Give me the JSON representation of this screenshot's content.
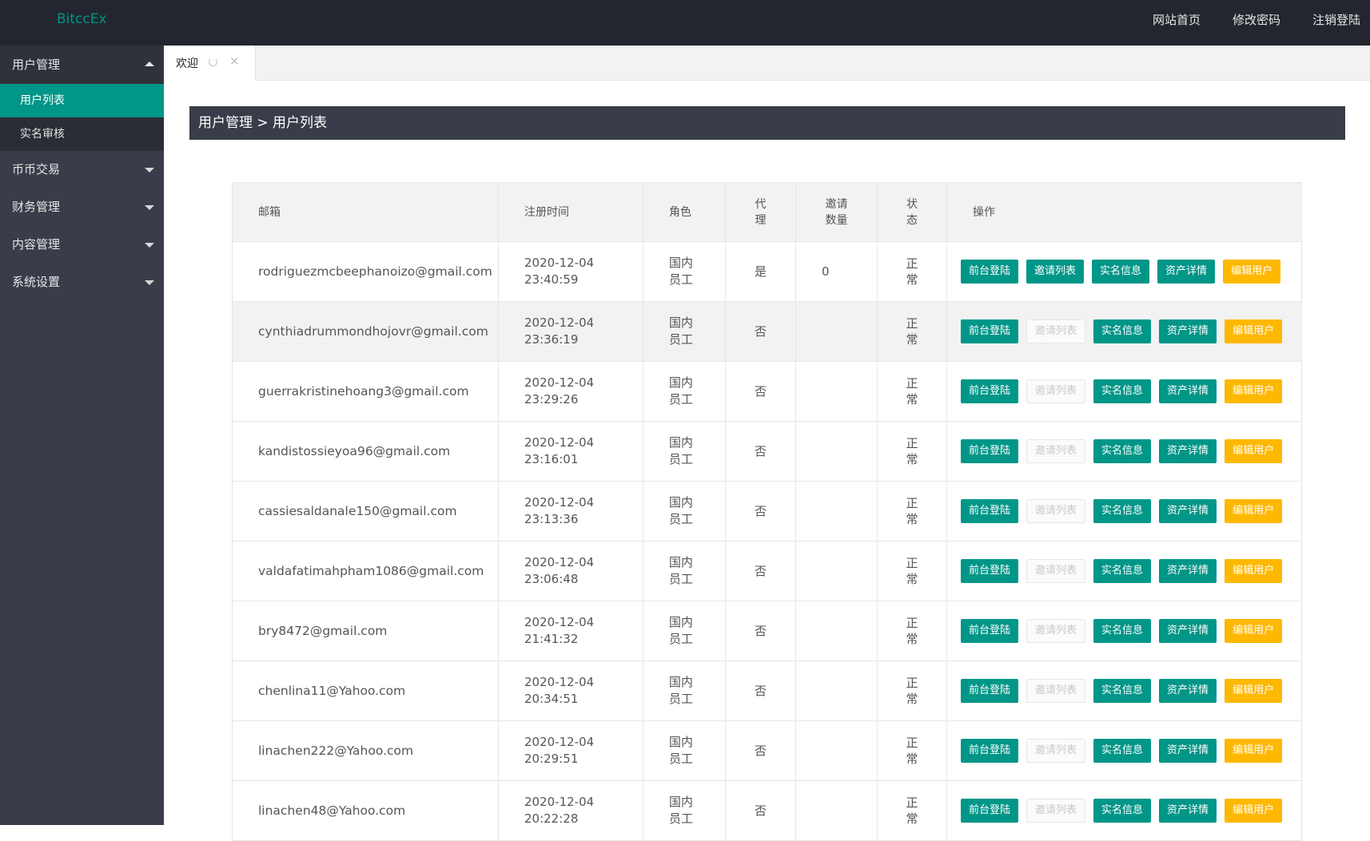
{
  "header": {
    "logo": "BitccEx",
    "nav": [
      "网站首页",
      "修改密码",
      "注销登陆"
    ]
  },
  "sidebar": {
    "menus": [
      {
        "label": "用户管理",
        "open": true,
        "children": [
          {
            "label": "用户列表",
            "active": true
          },
          {
            "label": "实名审核",
            "active": false
          }
        ]
      },
      {
        "label": "币币交易",
        "open": false
      },
      {
        "label": "财务管理",
        "open": false
      },
      {
        "label": "内容管理",
        "open": false
      },
      {
        "label": "系统设置",
        "open": false
      }
    ]
  },
  "tab": {
    "label": "欢迎",
    "close_glyph": "×"
  },
  "breadcrumb": "用户管理 > 用户列表",
  "table": {
    "headers": {
      "email": "邮箱",
      "reg_time": "注册时间",
      "role": "角色",
      "agent": "代理",
      "invite_count": "邀请数量",
      "status": "状态",
      "ops": "操作"
    },
    "buttons": {
      "login": "前台登陆",
      "invites": "邀请列表",
      "realname": "实名信息",
      "assets": "资产详情",
      "edit": "编辑用户"
    },
    "rows": [
      {
        "email": "rodriguezmcbeephanoizo@gmail.com",
        "date": "2020-12-04",
        "time": "23:40:59",
        "role": "国内员工",
        "agent": "是",
        "invites": "0",
        "status": "正常",
        "invite_enabled": true,
        "highlight": false
      },
      {
        "email": "cynthiadrummondhojovr@gmail.com",
        "date": "2020-12-04",
        "time": "23:36:19",
        "role": "国内员工",
        "agent": "否",
        "invites": "",
        "status": "正常",
        "invite_enabled": false,
        "highlight": true
      },
      {
        "email": "guerrakristinehoang3@gmail.com",
        "date": "2020-12-04",
        "time": "23:29:26",
        "role": "国内员工",
        "agent": "否",
        "invites": "",
        "status": "正常",
        "invite_enabled": false,
        "highlight": false
      },
      {
        "email": "kandistossieyoa96@gmail.com",
        "date": "2020-12-04",
        "time": "23:16:01",
        "role": "国内员工",
        "agent": "否",
        "invites": "",
        "status": "正常",
        "invite_enabled": false,
        "highlight": false
      },
      {
        "email": "cassiesaldanale150@gmail.com",
        "date": "2020-12-04",
        "time": "23:13:36",
        "role": "国内员工",
        "agent": "否",
        "invites": "",
        "status": "正常",
        "invite_enabled": false,
        "highlight": false
      },
      {
        "email": "valdafatimahpham1086@gmail.com",
        "date": "2020-12-04",
        "time": "23:06:48",
        "role": "国内员工",
        "agent": "否",
        "invites": "",
        "status": "正常",
        "invite_enabled": false,
        "highlight": false
      },
      {
        "email": "bry8472@gmail.com",
        "date": "2020-12-04",
        "time": "21:41:32",
        "role": "国内员工",
        "agent": "否",
        "invites": "",
        "status": "正常",
        "invite_enabled": false,
        "highlight": false
      },
      {
        "email": "chenlina11@Yahoo.com",
        "date": "2020-12-04",
        "time": "20:34:51",
        "role": "国内员工",
        "agent": "否",
        "invites": "",
        "status": "正常",
        "invite_enabled": false,
        "highlight": false
      },
      {
        "email": "linachen222@Yahoo.com",
        "date": "2020-12-04",
        "time": "20:29:51",
        "role": "国内员工",
        "agent": "否",
        "invites": "",
        "status": "正常",
        "invite_enabled": false,
        "highlight": false
      },
      {
        "email": "linachen48@Yahoo.com",
        "date": "2020-12-04",
        "time": "20:22:28",
        "role": "国内员工",
        "agent": "否",
        "invites": "",
        "status": "正常",
        "invite_enabled": false,
        "highlight": false
      }
    ]
  }
}
